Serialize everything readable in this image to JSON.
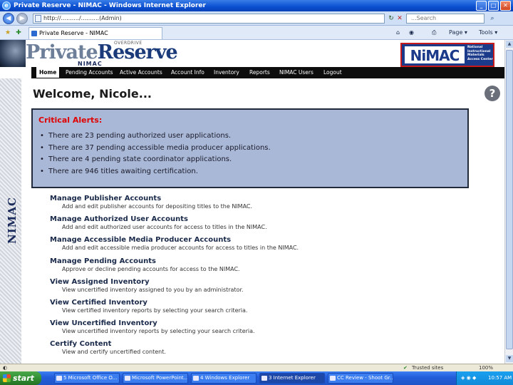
{
  "window": {
    "title": "Private Reserve - NIMAC - Windows Internet Explorer"
  },
  "address": {
    "url": "http://........../..........(Admin)",
    "search_placeholder": "...Search"
  },
  "tab": {
    "label": "Private Reserve - NIMAC"
  },
  "commands": {
    "page": "Page",
    "tools": "Tools"
  },
  "brand": {
    "overdrive": "OVERDRIVE",
    "private": "Private",
    "reserve": "Reserve",
    "sub": "NIMAC",
    "nimac_logo": "NiMAC",
    "nimac_full": "National Instructional Materials Access Center"
  },
  "nav": {
    "items": [
      "Home",
      "Pending Accounts",
      "Active Accounts",
      "Account Info",
      "Inventory",
      "Reports",
      "NIMAC Users",
      "Logout"
    ]
  },
  "side_label": "NIMAC",
  "welcome": "Welcome, Nicole...",
  "alerts": {
    "title": "Critical Alerts:",
    "items": [
      "There are 23 pending authorized user applications.",
      "There are 37 pending accessible media producer applications.",
      "There are 4 pending state coordinator applications.",
      "There are 946 titles awaiting certification."
    ]
  },
  "links": [
    {
      "title": "Manage Publisher Accounts",
      "desc": "Add and edit publisher accounts for depositing titles to the NIMAC."
    },
    {
      "title": "Manage Authorized User Accounts",
      "desc": "Add and edit authorized user accounts for access to titles in the NIMAC."
    },
    {
      "title": "Manage Accessible Media Producer Accounts",
      "desc": "Add and edit accessible media producer accounts for access to titles in the NIMAC."
    },
    {
      "title": "Manage Pending Accounts",
      "desc": "Approve or decline pending accounts for access to the NIMAC."
    },
    {
      "title": "View Assigned Inventory",
      "desc": "View uncertified inventory assigned to you by an administrator."
    },
    {
      "title": "View Certified Inventory",
      "desc": "View certified inventory reports by selecting your search criteria."
    },
    {
      "title": "View Uncertified Inventory",
      "desc": "View uncertified inventory reports by selecting your search criteria."
    },
    {
      "title": "Certify Content",
      "desc": "View and certify uncertified content."
    }
  ],
  "status": {
    "zone": "Trusted sites",
    "zoom": "100%"
  },
  "taskbar": {
    "start": "start",
    "items": [
      "5 Microsoft Office O...",
      "Microsoft PowerPoint...",
      "4 Windows Explorer",
      "3 Internet Explorer",
      "CC Review - Shoot Gr..."
    ],
    "clock": "10:57 AM"
  }
}
